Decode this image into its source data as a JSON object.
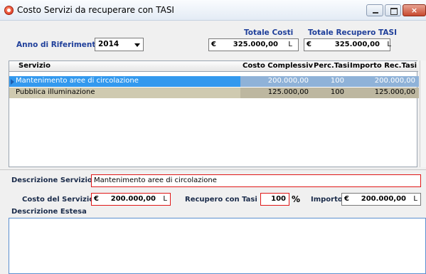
{
  "window": {
    "title": "Costo Servizi da recuperare con TASI",
    "close_glyph": "×"
  },
  "header": {
    "anno_label": "Anno di Riferimento",
    "anno_value": "2014",
    "totale_costi_label": "Totale Costi",
    "totale_recupero_label": "Totale Recupero TASI",
    "currency": "€",
    "unit": "L",
    "totale_costi_value": "325.000,00",
    "totale_recupero_value": "325.000,00"
  },
  "grid": {
    "columns": [
      "Servizio",
      "Costo Complessiv",
      "Perc.Tasi",
      "Importo Rec.Tasi"
    ],
    "rows": [
      {
        "servizio": "Mantenimento aree di circolazione",
        "costo": "200.000,00",
        "perc": "100",
        "importo": "200.000,00"
      },
      {
        "servizio": "Pubblica illuminazione",
        "costo": "125.000,00",
        "perc": "100",
        "importo": "125.000,00"
      }
    ]
  },
  "form": {
    "descrizione_label": "Descrizione Servizio",
    "descrizione_value": "Mantenimento aree di circolazione",
    "costo_label": "Costo del Servizio",
    "costo_value": "200.000,00",
    "recupero_label": "Recupero con Tasi",
    "recupero_value": "100",
    "percent_sign": "%",
    "importo_label": "Importo",
    "importo_value": "200.000,00",
    "estesa_label": "Descrizione Estesa",
    "estesa_value": ""
  }
}
